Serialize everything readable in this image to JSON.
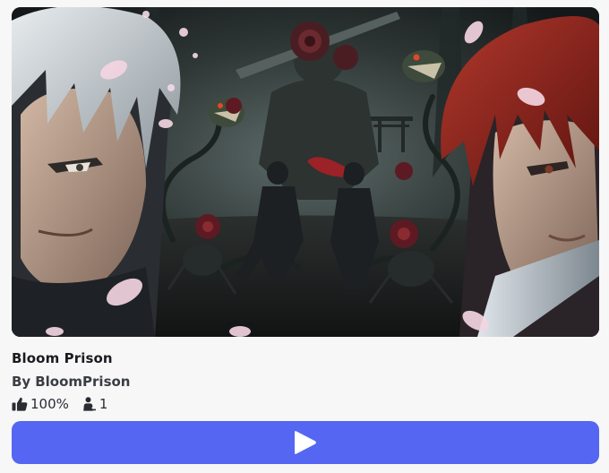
{
  "experience": {
    "title": "Bloom Prison",
    "creator_prefix": "By",
    "creator_name": "BloomPrison"
  },
  "stats": {
    "like_ratio": "100%",
    "player_count": "1"
  },
  "thumbnail": {
    "description_icon": "game-thumbnail-image"
  },
  "play_button": {
    "icon": "play-icon"
  },
  "colors": {
    "play_button": "#5566f2",
    "background": "#f7f7f8"
  }
}
